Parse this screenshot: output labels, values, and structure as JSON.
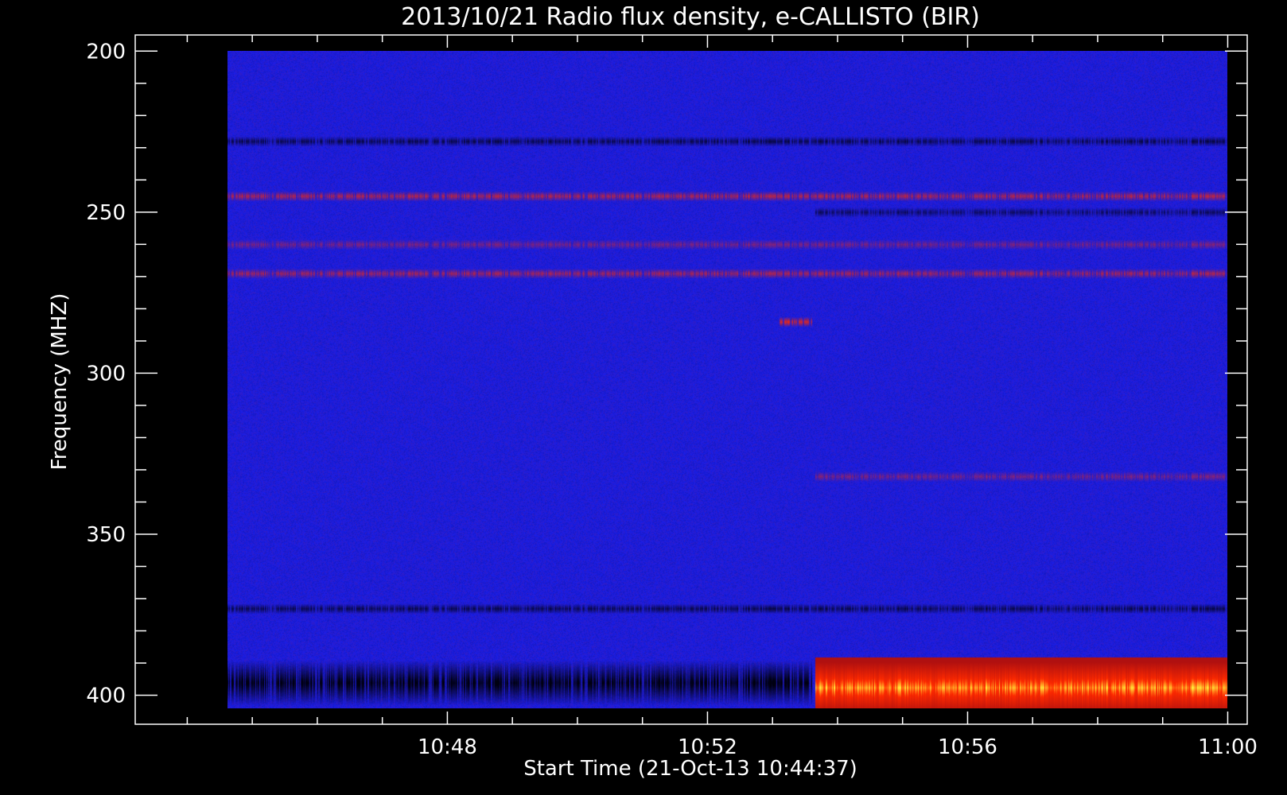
{
  "chart_data": {
    "type": "heatmap",
    "title": "2013/10/21  Radio flux density, e-CALLISTO (BIR)",
    "xlabel": "Start Time (21-Oct-13 10:44:37)",
    "ylabel": "Frequency (MHZ)",
    "y_reversed": true,
    "ylim": [
      195,
      409
    ],
    "xlim_minutes_from_1044": [
      -0.8,
      16.3
    ],
    "data_extent": {
      "x_start": "10:44:37",
      "x_end": "11:00:00",
      "y_start": 200,
      "y_end": 404
    },
    "x_ticks": [
      {
        "label": "10:48",
        "minute": 4
      },
      {
        "label": "10:52",
        "minute": 8
      },
      {
        "label": "10:56",
        "minute": 12
      },
      {
        "label": "11:00",
        "minute": 16
      }
    ],
    "y_ticks": [
      {
        "label": "200",
        "value": 200
      },
      {
        "label": "250",
        "value": 250
      },
      {
        "label": "300",
        "value": 300
      },
      {
        "label": "350",
        "value": 350
      },
      {
        "label": "400",
        "value": 400
      }
    ],
    "colormap": {
      "background": "#1a1ee8",
      "low": "#000010",
      "mid": "#b01010",
      "high": "#ff2a00",
      "peak": "#ffff40"
    },
    "features": [
      {
        "kind": "dark_band",
        "freq": 228,
        "start_min": 0.6,
        "end_min": 16.0,
        "strength": 0.6
      },
      {
        "kind": "red_band",
        "freq": 245,
        "start_min": 0.6,
        "end_min": 16.0,
        "strength": 0.55
      },
      {
        "kind": "dark_band",
        "freq": 250,
        "start_min": 9.65,
        "end_min": 16.0,
        "strength": 0.5
      },
      {
        "kind": "red_band",
        "freq": 260,
        "start_min": 0.6,
        "end_min": 16.0,
        "strength": 0.35
      },
      {
        "kind": "red_band",
        "freq": 269,
        "start_min": 0.6,
        "end_min": 16.0,
        "strength": 0.5
      },
      {
        "kind": "red_band",
        "freq": 284,
        "start_min": 9.1,
        "end_min": 9.6,
        "strength": 0.7
      },
      {
        "kind": "red_band",
        "freq": 332,
        "start_min": 9.65,
        "end_min": 16.0,
        "strength": 0.35
      },
      {
        "kind": "dark_band",
        "freq": 373,
        "start_min": 0.6,
        "end_min": 16.0,
        "strength": 0.6
      },
      {
        "kind": "dark_band",
        "freq": 396,
        "start_min": 0.6,
        "end_min": 9.6,
        "strength": 0.9
      },
      {
        "kind": "burst",
        "freq_low": 388,
        "freq_high": 404,
        "start_min": 9.65,
        "end_min": 16.0,
        "strength": 1.0
      }
    ]
  }
}
